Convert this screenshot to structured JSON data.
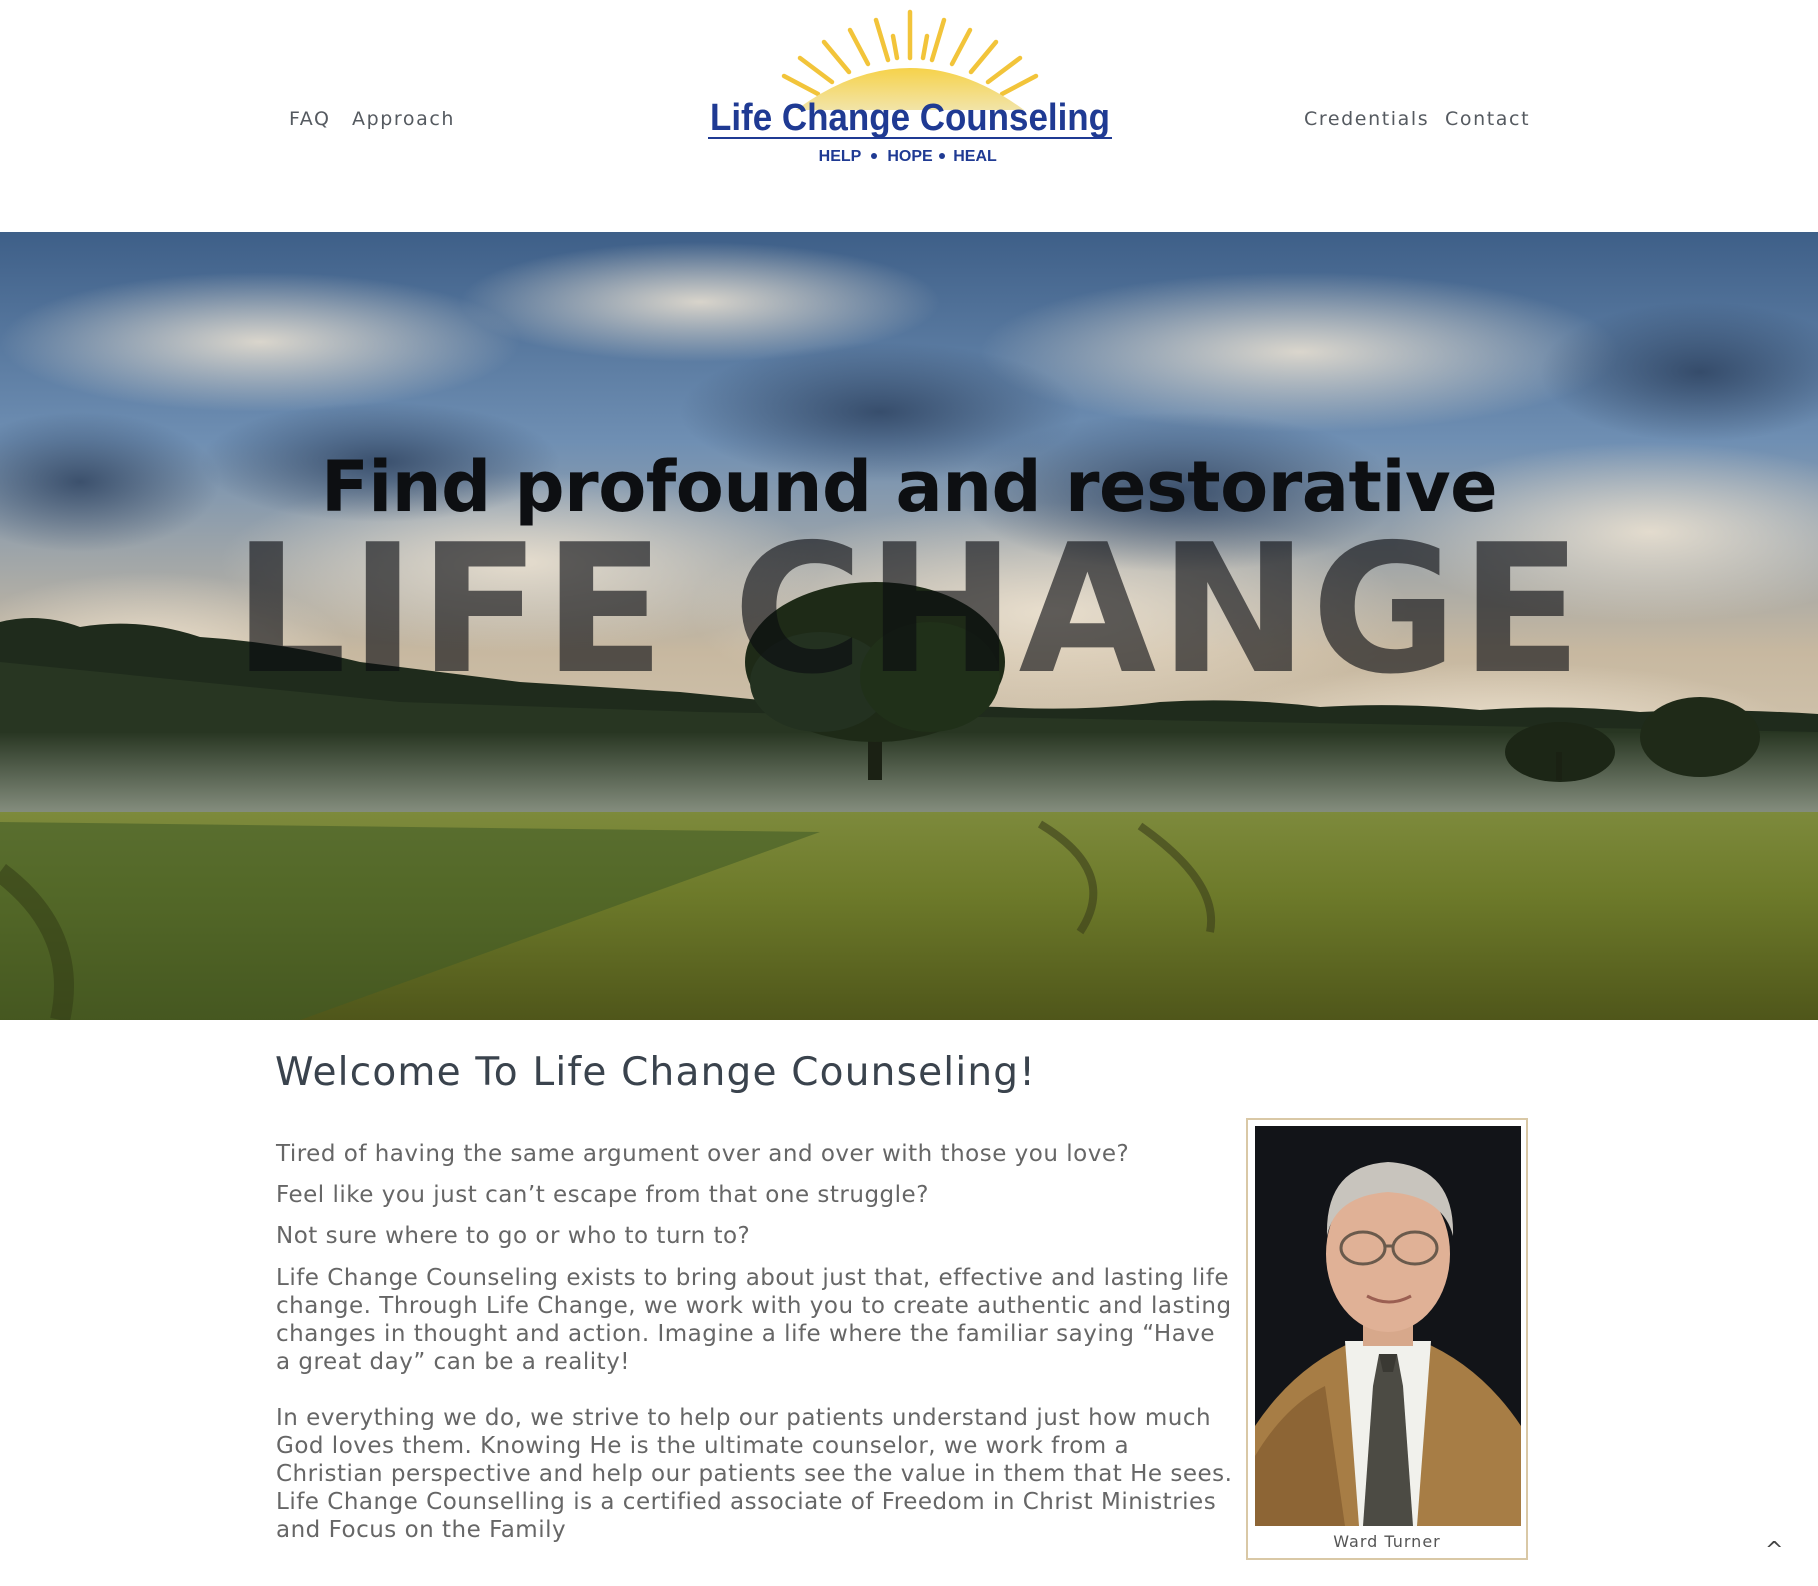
{
  "header": {
    "nav_left": [
      {
        "label": "FAQ"
      },
      {
        "label": "Approach"
      }
    ],
    "nav_right": [
      {
        "label": "Credentials"
      },
      {
        "label": "Contact"
      }
    ],
    "logo": {
      "name": "Life Change Counseling",
      "tagline_words": [
        "HELP",
        "HOPE",
        "HEAL"
      ],
      "icon": "rising-sun-logo"
    }
  },
  "hero": {
    "subtitle": "Find profound and restorative",
    "title": "LIFE CHANGE",
    "image": "field-with-tree-under-cloudy-sky"
  },
  "main": {
    "title": "Welcome To Life Change Counseling!",
    "questions": [
      "Tired of having the same argument over and over with those you love?",
      "Feel like you just can’t escape from that one struggle?",
      "Not sure where to go or who to turn to?"
    ],
    "paragraph_1": "Life Change Counseling exists to bring about just that, effective and lasting life change. Through Life Change, we work with you to create authentic and lasting changes in thought and action. Imagine a life where the familiar saying “Have a great day” can be a reality!",
    "paragraph_2": "In everything we do, we strive to help our patients understand just how much God loves them. Knowing He is the ultimate counselor, we work from a Christian perspective and help our patients see the value in them that He sees. Life Change Counselling is a certified associate of Freedom in Christ Ministries and Focus on the Family",
    "photo": {
      "caption": "Ward Turner",
      "image": "portrait-of-counselor"
    }
  },
  "back_to_top": {
    "label": "^",
    "icon": "caret-up-icon"
  },
  "colors": {
    "nav_text": "#555a60",
    "logo_blue": "#1f3a93",
    "sun_yellow": "#f2c43a",
    "heading_text": "#3a434d",
    "body_text": "#666666",
    "photo_border": "#d9c8a6"
  }
}
